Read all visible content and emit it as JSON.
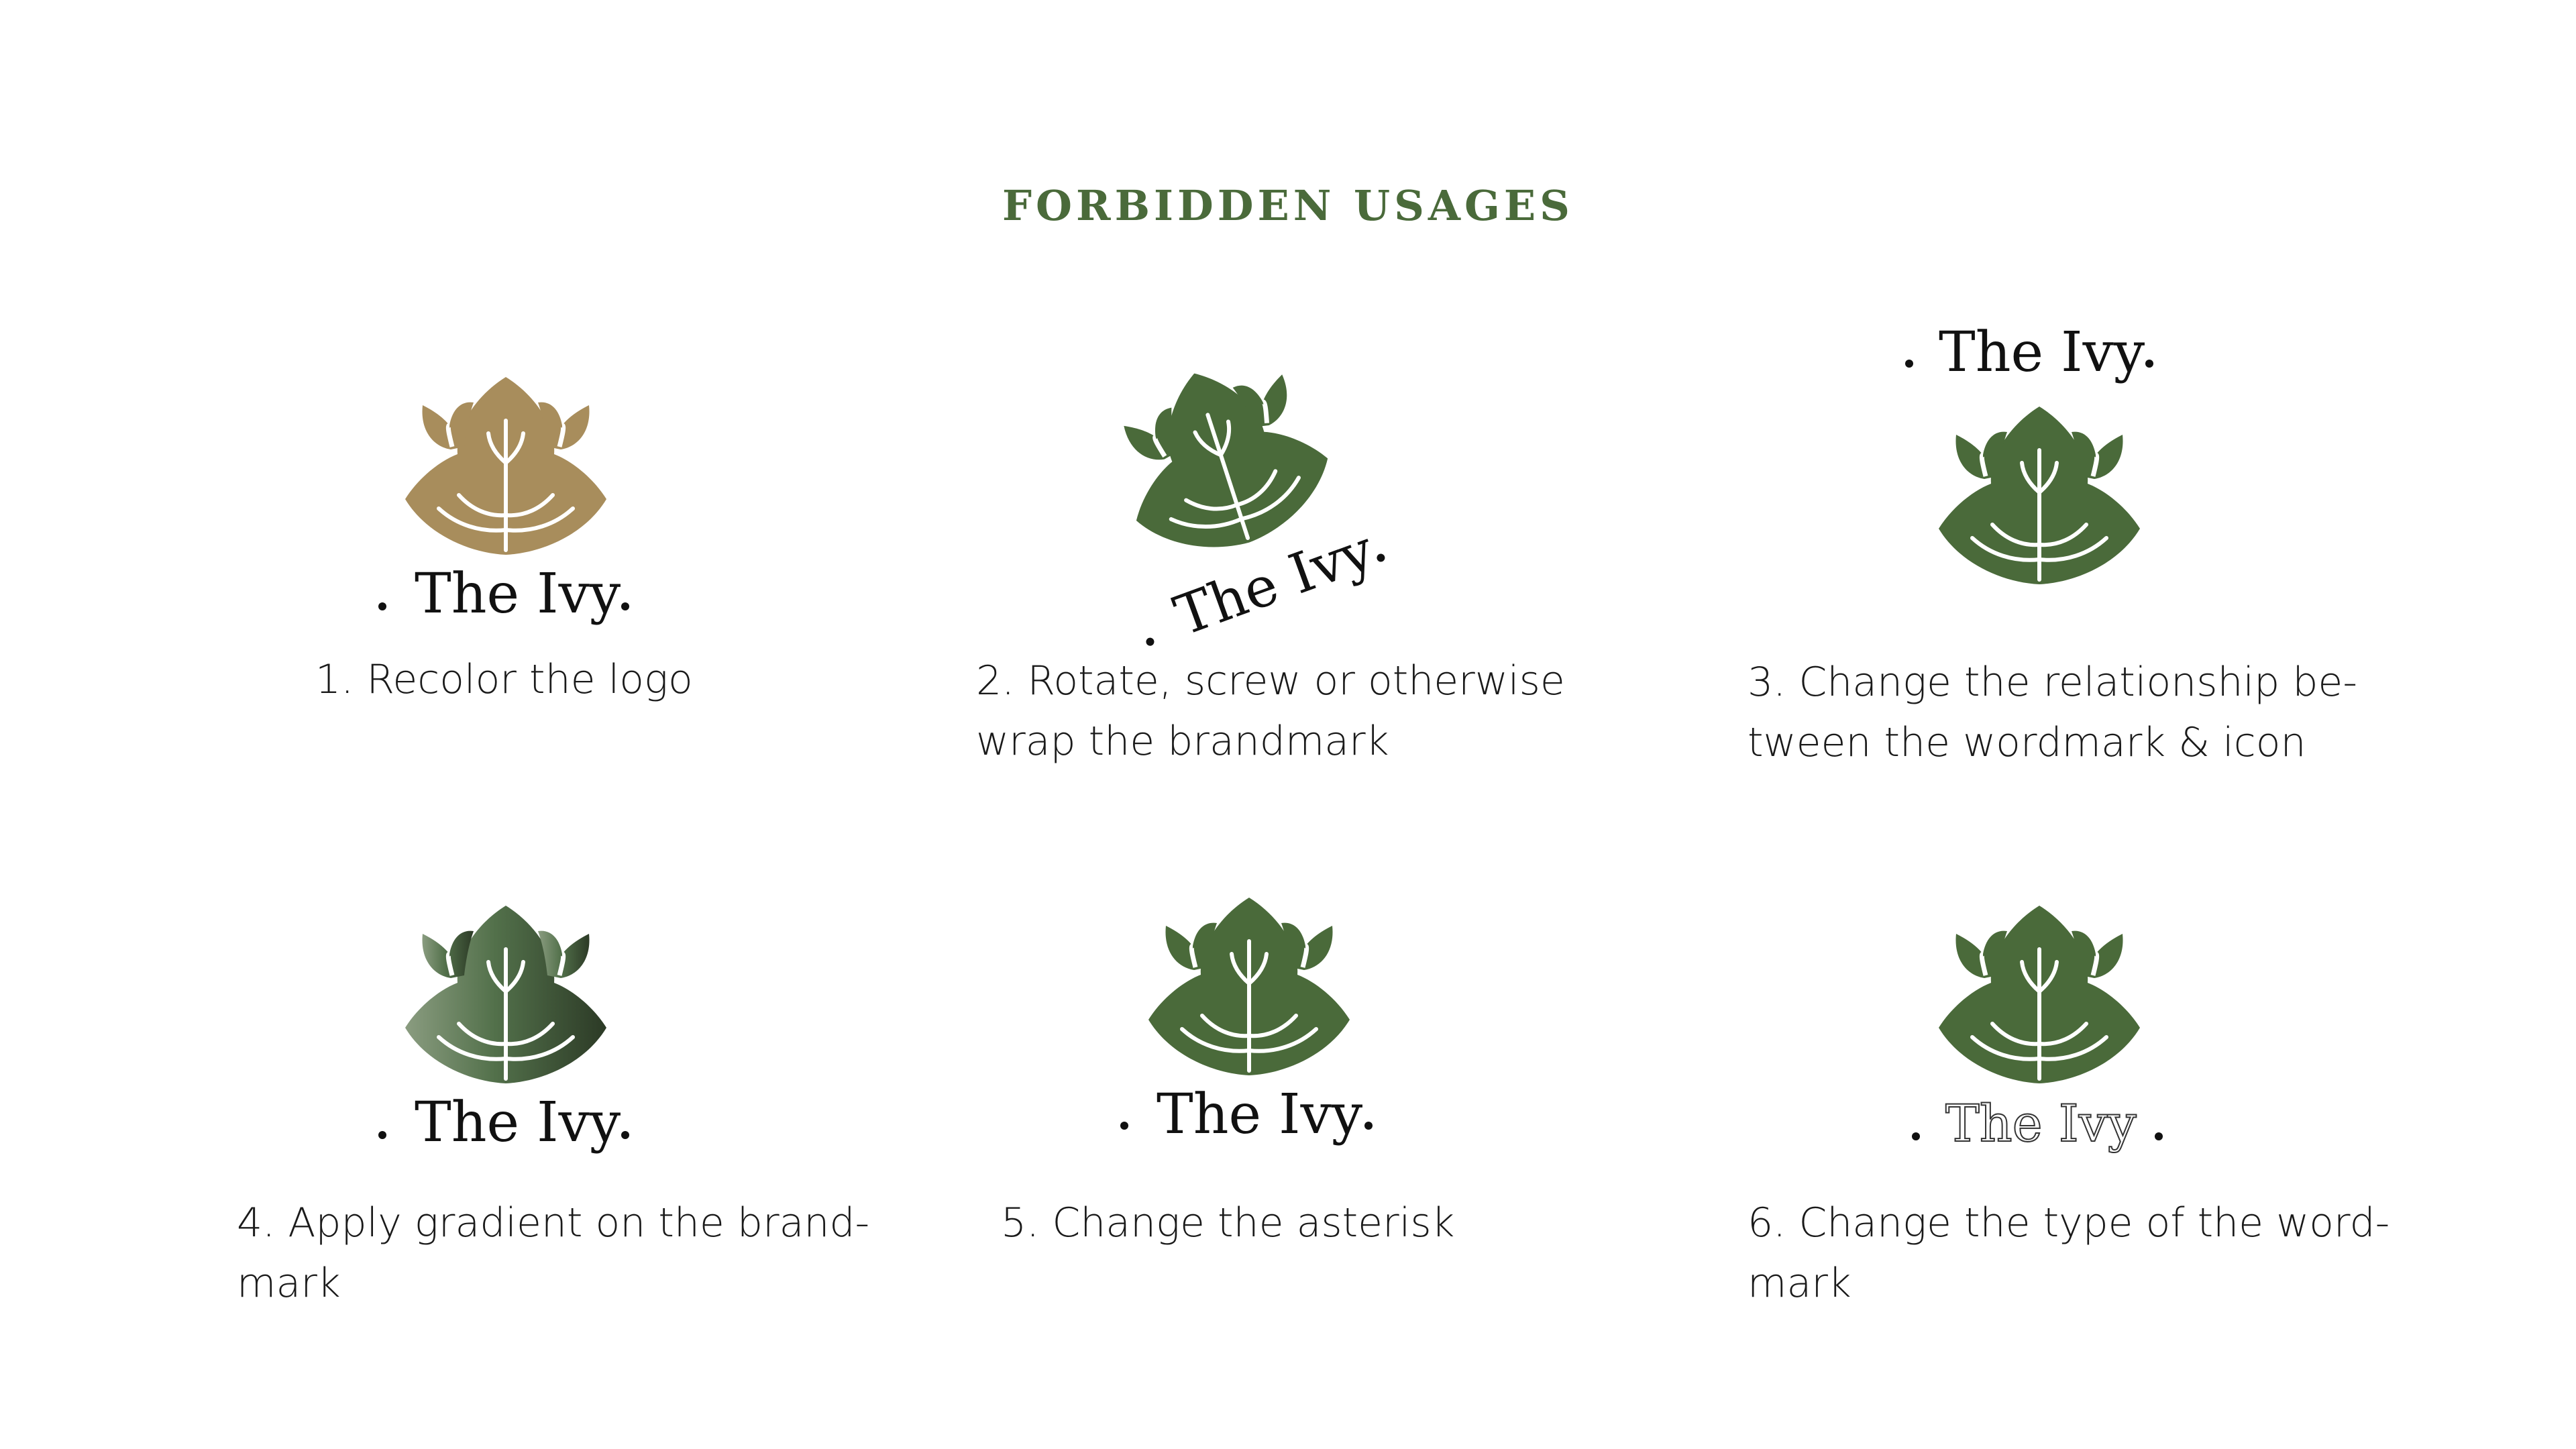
{
  "page": {
    "title": "FORBIDDEN USAGES"
  },
  "colors": {
    "brand_green": "#4a6a3a",
    "recolor_gold": "#a88d5c",
    "text_dark": "#111111"
  },
  "items": [
    {
      "wordmark": "The Ivy",
      "caption_line1": "1. Recolor the logo",
      "caption_line2": ""
    },
    {
      "wordmark": "The Ivy",
      "caption_line1": "2. Rotate, screw or otherwise",
      "caption_line2": "wrap the brandmark"
    },
    {
      "wordmark": "The Ivy",
      "caption_line1": "3. Change the relationship be-",
      "caption_line2": "tween the wordmark & icon"
    },
    {
      "wordmark": "The Ivy",
      "caption_line1": "4. Apply gradient on the brand-",
      "caption_line2": "mark"
    },
    {
      "wordmark": "The Ivy",
      "caption_line1": "5. Change the asterisk",
      "caption_line2": ""
    },
    {
      "wordmark": "The Ivy",
      "caption_line1": "6. Change the type of the word-",
      "caption_line2": "mark"
    }
  ],
  "icons": {
    "leaf": "ivy-leaf-icon"
  }
}
